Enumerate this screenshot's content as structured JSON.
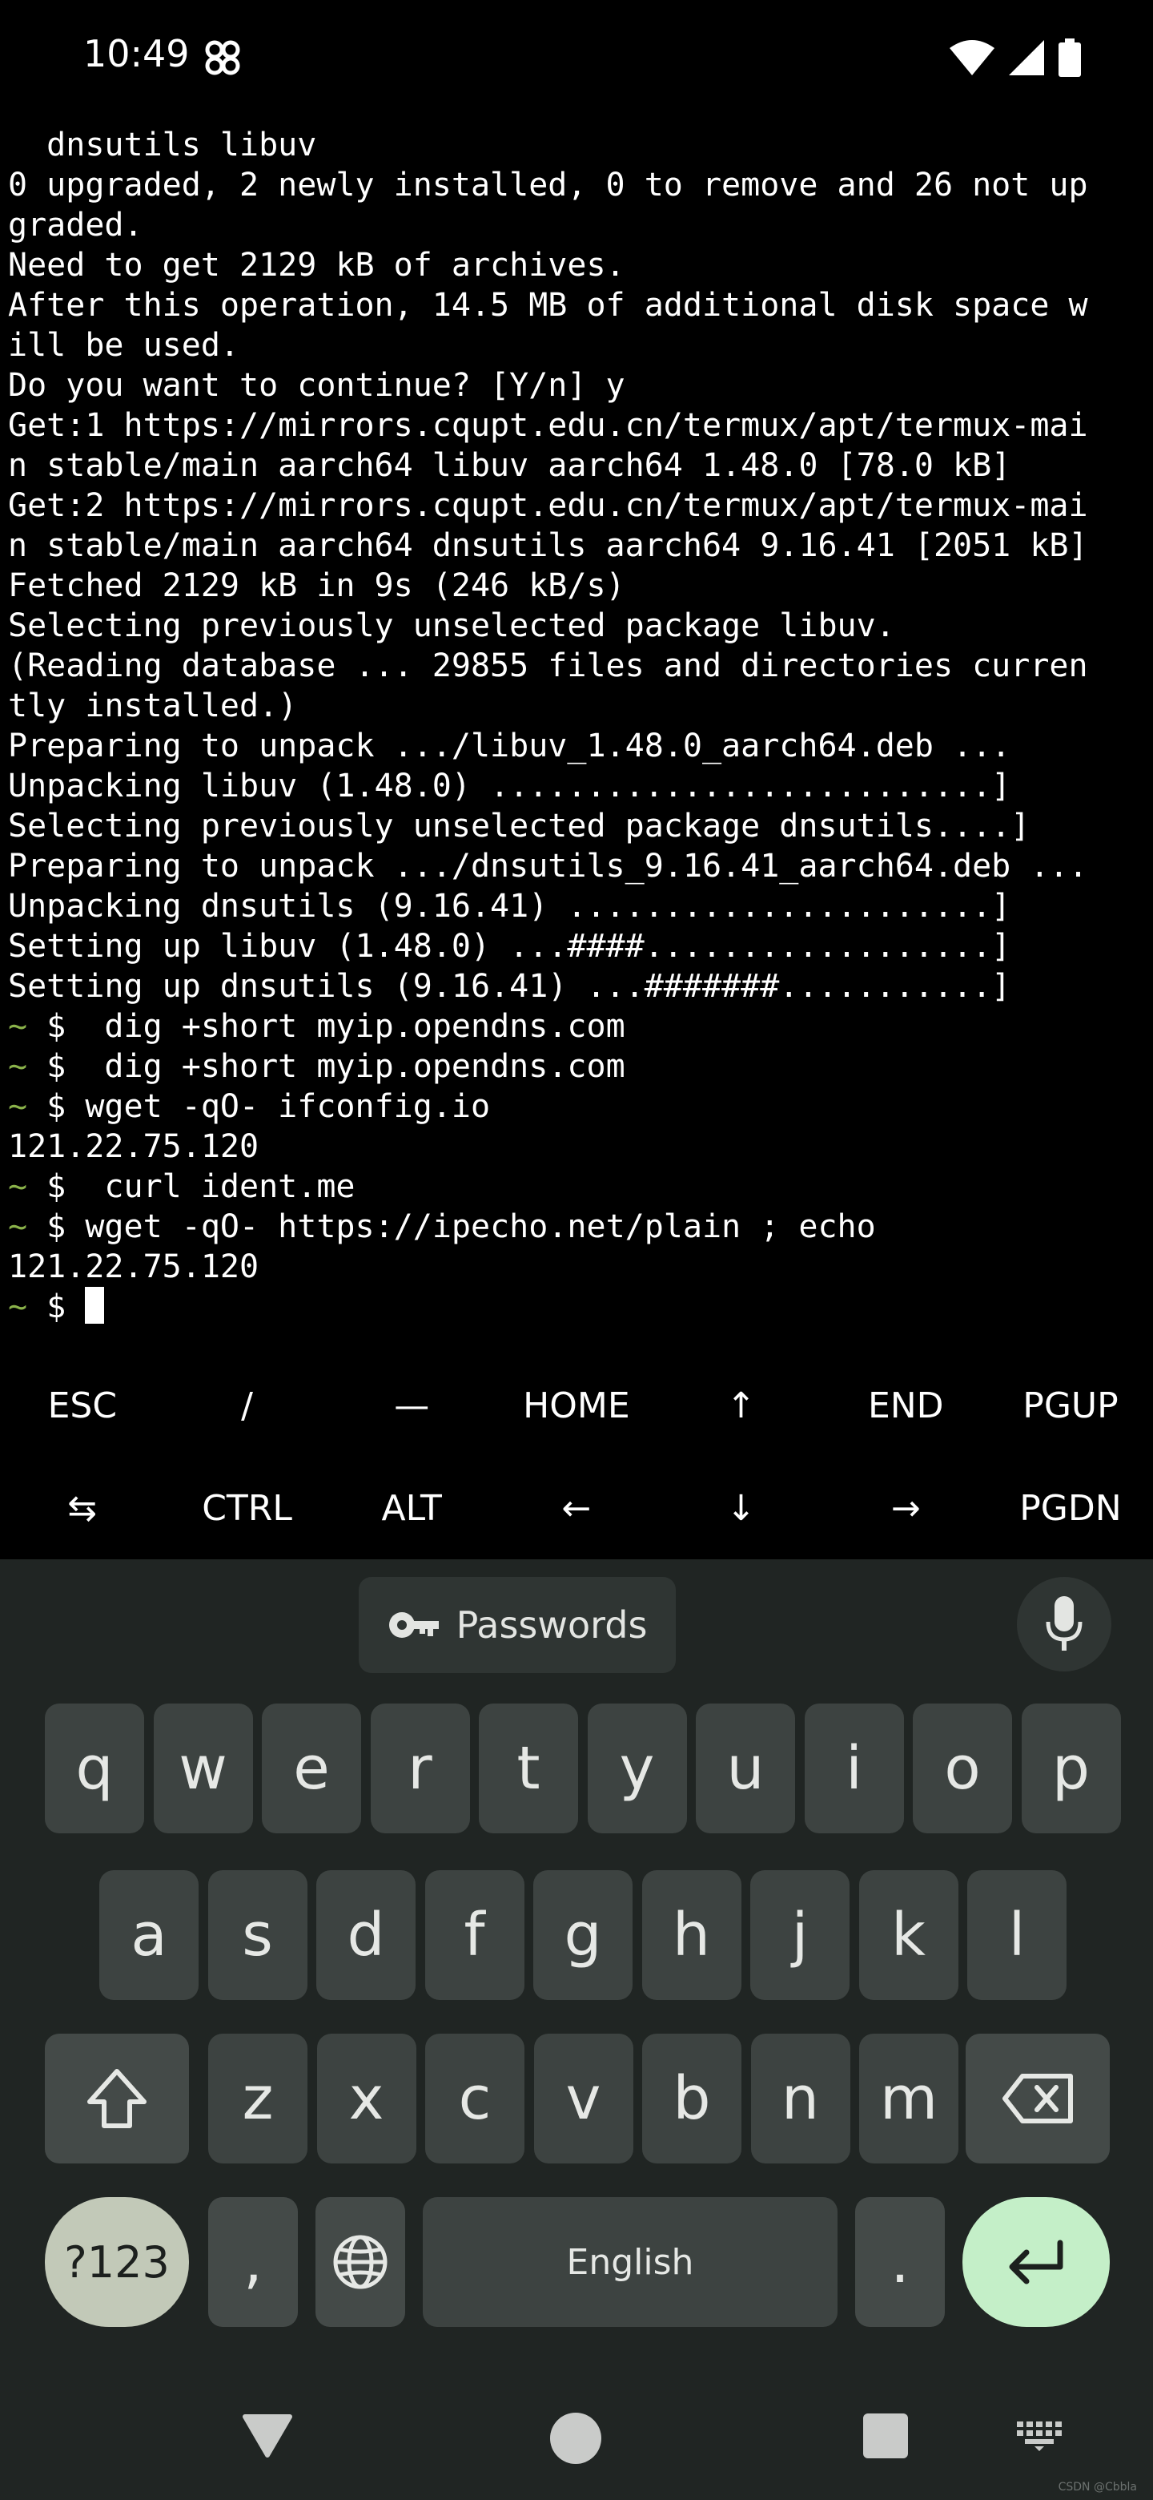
{
  "status_bar": {
    "time": "10:49"
  },
  "terminal": {
    "lines": [
      "  dnsutils libuv",
      "0 upgraded, 2 newly installed, 0 to remove and 26 not up",
      "graded.",
      "Need to get 2129 kB of archives.",
      "After this operation, 14.5 MB of additional disk space w",
      "ill be used.",
      "Do you want to continue? [Y/n] y",
      "Get:1 https://mirrors.cqupt.edu.cn/termux/apt/termux-mai",
      "n stable/main aarch64 libuv aarch64 1.48.0 [78.0 kB]",
      "Get:2 https://mirrors.cqupt.edu.cn/termux/apt/termux-mai",
      "n stable/main aarch64 dnsutils aarch64 9.16.41 [2051 kB]",
      "Fetched 2129 kB in 9s (246 kB/s)",
      "Selecting previously unselected package libuv.",
      "(Reading database ... 29855 files and directories curren",
      "tly installed.)",
      "Preparing to unpack .../libuv_1.48.0_aarch64.deb ...",
      "Unpacking libuv (1.48.0) ..........................]",
      "Selecting previously unselected package dnsutils....]",
      "Preparing to unpack .../dnsutils_9.16.41_aarch64.deb ...",
      "Unpacking dnsutils (9.16.41) ......................]",
      "Setting up libuv (1.48.0) ...####..................]",
      "Setting up dnsutils (9.16.41) ...#######...........]"
    ],
    "prompt_tilde": "~",
    "prompt_symbol": "$",
    "commands": [
      {
        "cmd": "  dig +short myip.opendns.com",
        "output": ""
      },
      {
        "cmd": "  dig +short myip.opendns.com",
        "output": ""
      },
      {
        "cmd": " wget -qO- ifconfig.io",
        "output": "121.22.75.120"
      },
      {
        "cmd": "  curl ident.me",
        "output": ""
      },
      {
        "cmd": " wget -qO- https://ipecho.net/plain ; echo",
        "output": "121.22.75.120"
      }
    ]
  },
  "extra_keys": {
    "row1": [
      "ESC",
      "/",
      "—",
      "HOME",
      "↑",
      "END",
      "PGUP"
    ],
    "row2": [
      "⇆",
      "CTRL",
      "ALT",
      "←",
      "↓",
      "→",
      "PGDN"
    ]
  },
  "keyboard": {
    "passwords_label": "Passwords",
    "row1": [
      "q",
      "w",
      "e",
      "r",
      "t",
      "y",
      "u",
      "i",
      "o",
      "p"
    ],
    "row2": [
      "a",
      "s",
      "d",
      "f",
      "g",
      "h",
      "j",
      "k",
      "l"
    ],
    "row3": [
      "z",
      "x",
      "c",
      "v",
      "b",
      "n",
      "m"
    ],
    "num_label": "?123",
    "comma": ",",
    "space_label": "English",
    "period": ".",
    "colors": {
      "background": "#202523",
      "key": "#3d4341",
      "enter": "#c4efc8",
      "num": "#c2c9b8"
    }
  },
  "watermark": "CSDN @Cbbla"
}
